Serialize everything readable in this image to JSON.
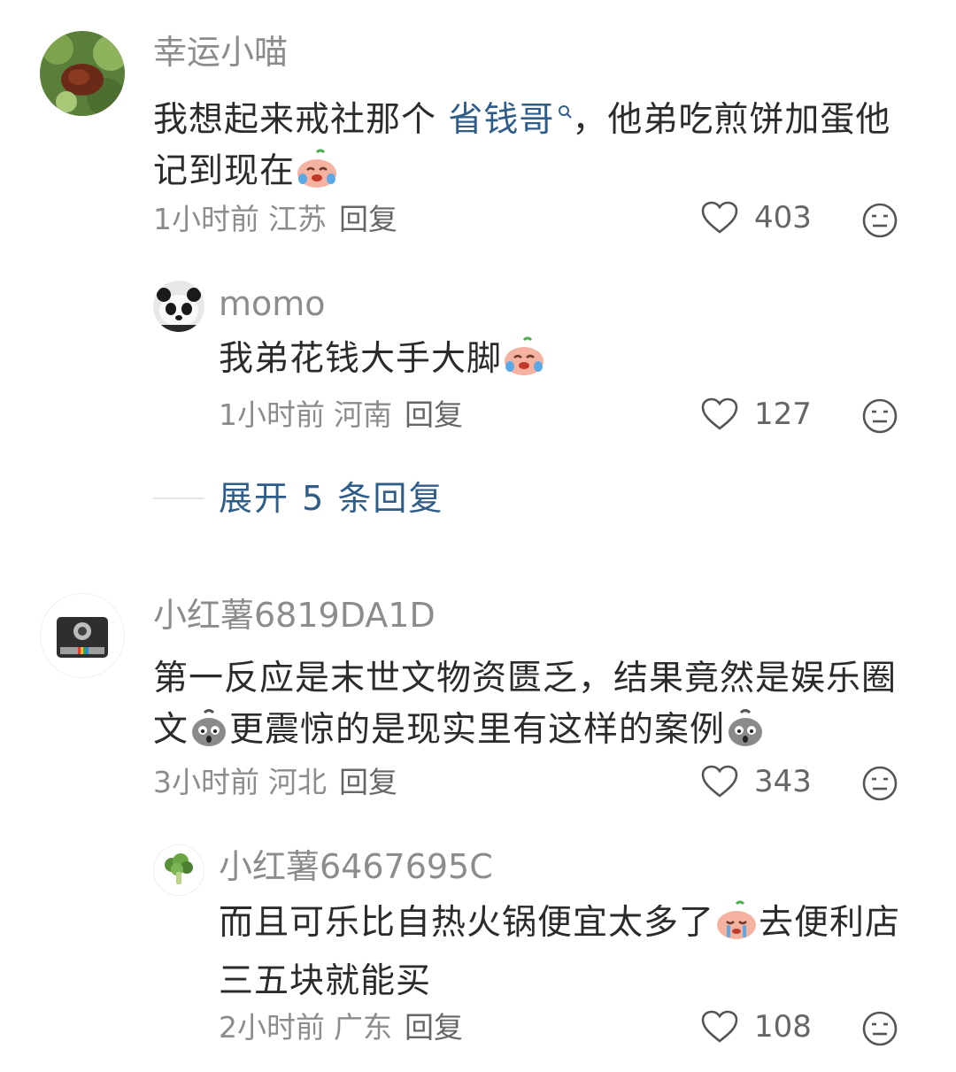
{
  "comments": [
    {
      "username": "幸运小喵",
      "text_before_link": "我想起来戒社那个 ",
      "link_text": "省钱哥",
      "text_after_link": "，他弟吃煎饼加蛋他记到现在",
      "time": "1小时前",
      "location": "江苏",
      "reply_label": "回复",
      "likes": "403",
      "avatar_icon": "red-panda-avatar"
    },
    {
      "username": "momo",
      "text": "我弟花钱大手大脚",
      "time": "1小时前",
      "location": "河南",
      "reply_label": "回复",
      "likes": "127",
      "avatar_icon": "panda-avatar"
    },
    {
      "username": "小红薯6819DA1D",
      "text_part1": "第一反应是末世文物资匮乏，结果竟然是娱乐圈文",
      "text_part2": "更震惊的是现实里有这样的案例",
      "time": "3小时前",
      "location": "河北",
      "reply_label": "回复",
      "likes": "343",
      "avatar_icon": "camera-avatar"
    },
    {
      "username": "小红薯6467695C",
      "text_part1": "而且可乐比自热火锅便宜太多了",
      "text_part2": "去便利店三五块就能买",
      "time": "2小时前",
      "location": "广东",
      "reply_label": "回复",
      "likes": "108",
      "avatar_icon": "broccoli-avatar"
    }
  ],
  "expand_replies": "展开 5 条回复",
  "colors": {
    "link": "#2f5d8a",
    "meta": "#8c8c8c",
    "text": "#2b2b2b"
  }
}
